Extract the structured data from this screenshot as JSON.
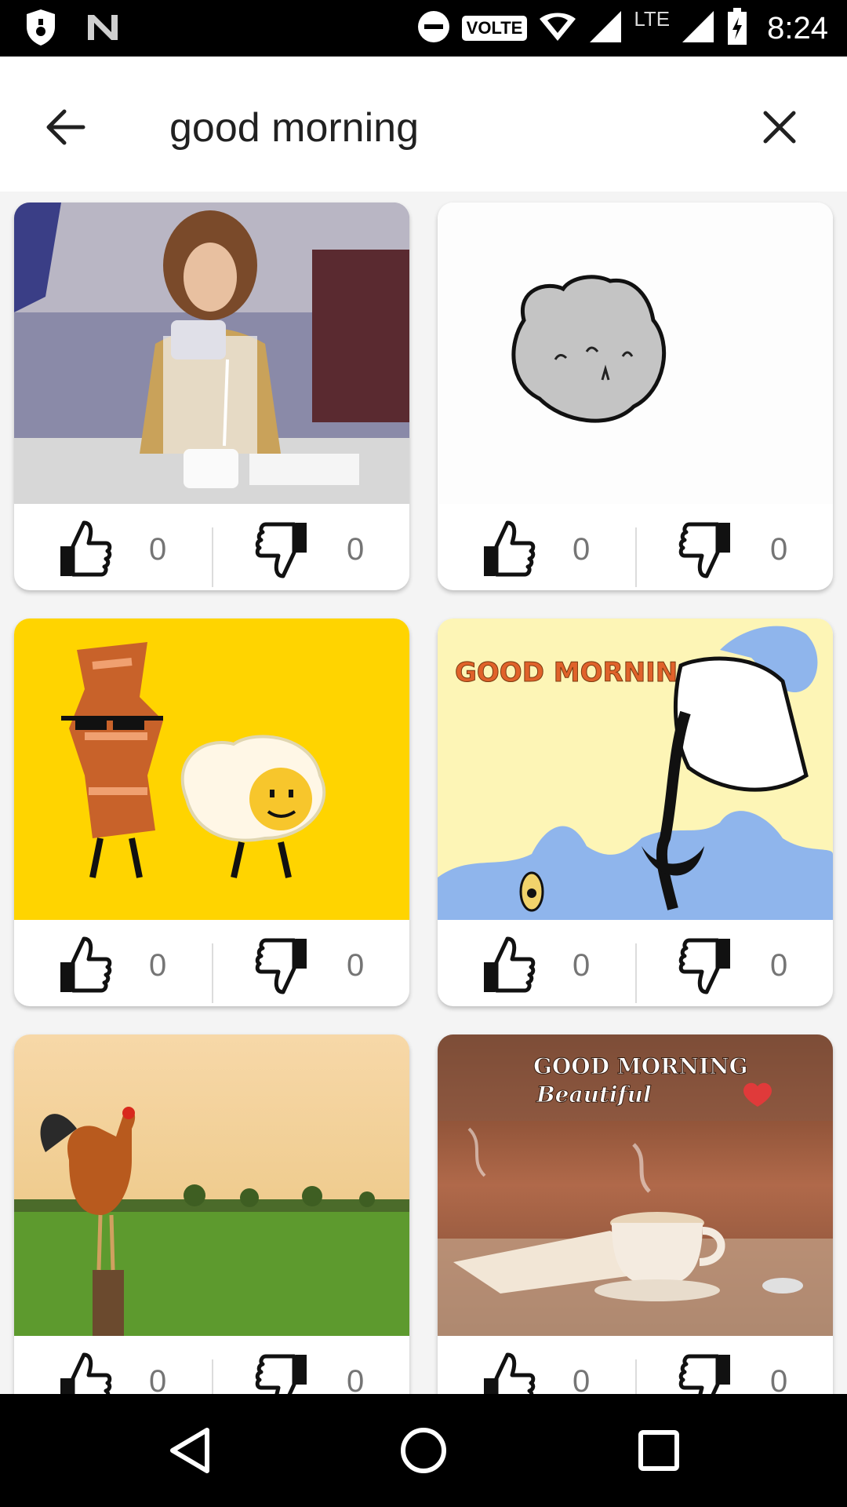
{
  "status_bar": {
    "time": "8:24",
    "volte_label": "VOLTE",
    "network_label": "LTE",
    "icons": [
      "shield-icon",
      "n-icon",
      "dnd-icon",
      "wifi-icon",
      "signal-icon",
      "signal-lte-icon",
      "battery-charging-icon"
    ]
  },
  "search": {
    "query": "good morning",
    "back_icon": "arrow-back-icon",
    "clear_icon": "close-icon"
  },
  "results": [
    {
      "label": "woman pouring coffee gif",
      "likes": "0",
      "dislikes": "0"
    },
    {
      "label": "sleepy rock character gif",
      "likes": "0",
      "dislikes": "0"
    },
    {
      "label": "bacon and egg dancing gif",
      "likes": "0",
      "dislikes": "0"
    },
    {
      "label": "coffee into mouth gif",
      "caption": "GOOD MORNING",
      "likes": "0",
      "dislikes": "0"
    },
    {
      "label": "rooster at sunrise gif",
      "likes": "0",
      "dislikes": "0"
    },
    {
      "label": "coffee cup good morning gif",
      "caption": "GOOD MORNING",
      "caption2": "Beautiful",
      "likes": "0",
      "dislikes": "0"
    }
  ],
  "colors": {
    "background": "#f4f4f4",
    "card": "#ffffff",
    "count_text": "#757575",
    "bars": "#000000"
  },
  "nav_bar": {
    "icons": [
      "back-triangle-icon",
      "home-circle-icon",
      "recents-square-icon"
    ]
  }
}
